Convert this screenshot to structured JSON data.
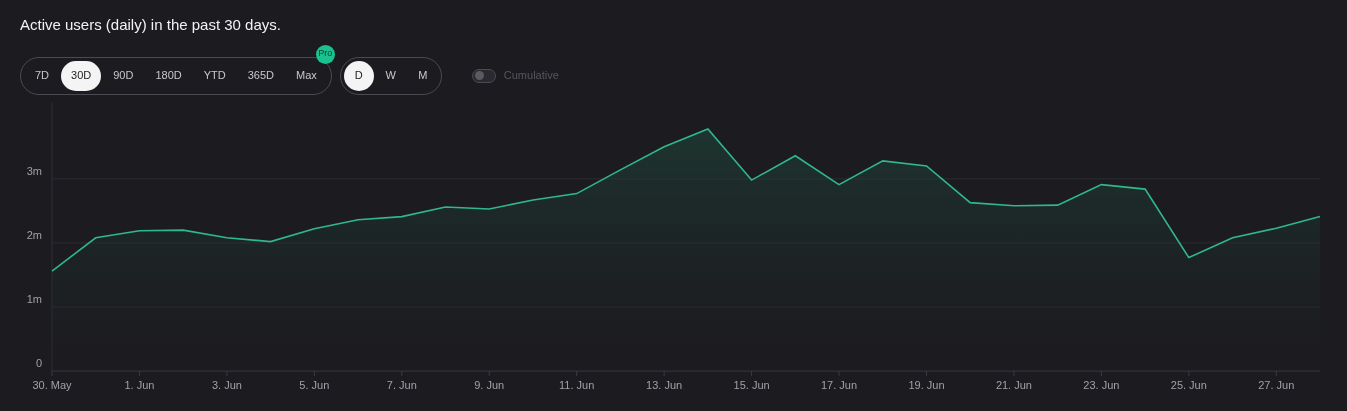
{
  "title": "Active users (daily) in the past 30 days.",
  "range_tabs": [
    {
      "label": "7D",
      "selected": false
    },
    {
      "label": "30D",
      "selected": true
    },
    {
      "label": "90D",
      "selected": false
    },
    {
      "label": "180D",
      "selected": false
    },
    {
      "label": "YTD",
      "selected": false
    },
    {
      "label": "365D",
      "selected": false
    },
    {
      "label": "Max",
      "selected": false,
      "badge": "Pro"
    }
  ],
  "interval_tabs": [
    {
      "label": "D",
      "selected": true
    },
    {
      "label": "W",
      "selected": false
    },
    {
      "label": "M",
      "selected": false
    }
  ],
  "cumulative": {
    "label": "Cumulative",
    "on": false
  },
  "chart_data": {
    "type": "area",
    "categories": [
      "30. May",
      null,
      "1. Jun",
      null,
      "3. Jun",
      null,
      "5. Jun",
      null,
      "7. Jun",
      null,
      "9. Jun",
      null,
      "11. Jun",
      null,
      "13. Jun",
      null,
      "15. Jun",
      null,
      "17. Jun",
      null,
      "19. Jun",
      null,
      "21. Jun",
      null,
      "23. Jun",
      null,
      "25. Jun",
      null,
      "27. Jun",
      null
    ],
    "series": [
      {
        "color": "#2fb88c",
        "values": [
          1.56,
          2.08,
          2.19,
          2.2,
          2.08,
          2.02,
          2.22,
          2.36,
          2.41,
          2.56,
          2.53,
          2.67,
          2.77,
          3.14,
          3.5,
          3.78,
          2.98,
          3.36,
          2.91,
          3.28,
          3.2,
          2.63,
          2.58,
          2.59,
          2.91,
          2.84,
          1.77,
          2.08,
          2.23,
          2.41
        ]
      }
    ],
    "grid": true,
    "ylim": [
      0,
      4.2
    ],
    "yticks": [
      {
        "value": 0,
        "label": "0"
      },
      {
        "value": 1,
        "label": "1m"
      },
      {
        "value": 2,
        "label": "2m"
      },
      {
        "value": 3,
        "label": "3m"
      }
    ]
  }
}
